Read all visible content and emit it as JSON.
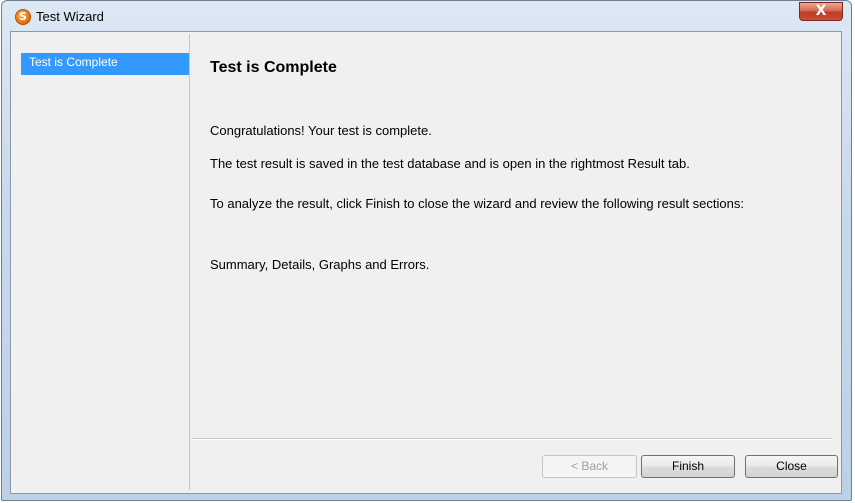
{
  "window": {
    "title": "Test Wizard",
    "close_label": "X"
  },
  "app_icon": {
    "glyph": "S",
    "name": "app-logo-icon"
  },
  "steps": [
    {
      "label": "Test is Complete",
      "selected": true
    }
  ],
  "page": {
    "heading": "Test is Complete",
    "paragraphs": [
      "Congratulations! Your test is complete.",
      "The test result is saved in the test database and is open in the rightmost Result tab.",
      "To analyze the result, click Finish to close the wizard and review the following result sections:",
      "Summary, Details, Graphs and Errors."
    ]
  },
  "buttons": {
    "back": {
      "label": "< Back",
      "enabled": false
    },
    "finish": {
      "label": "Finish",
      "enabled": true
    },
    "close": {
      "label": "Close",
      "enabled": true
    }
  },
  "colors": {
    "selection": "#3399ff",
    "dialog_bg": "#f0f0f0",
    "close_button": "#c84f35"
  }
}
